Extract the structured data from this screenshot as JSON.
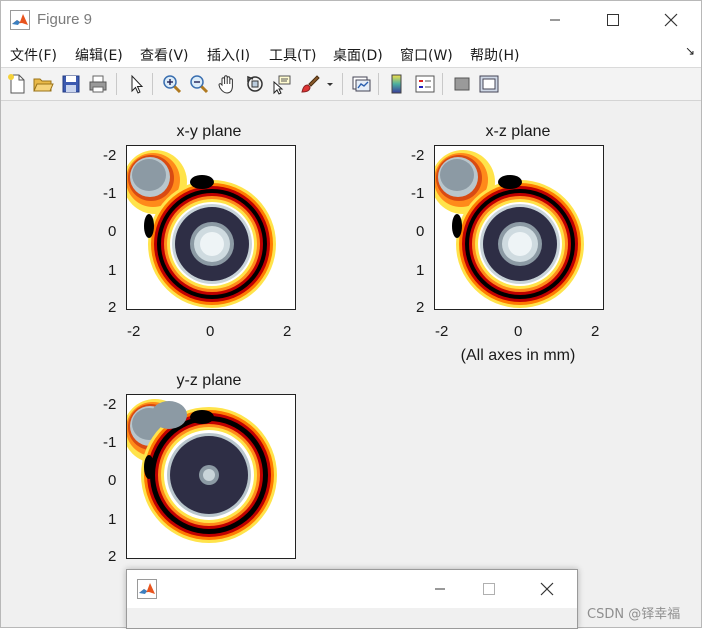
{
  "window": {
    "title": "Figure 9"
  },
  "menu": [
    "文件(F)",
    "编辑(E)",
    "查看(V)",
    "插入(I)",
    "工具(T)",
    "桌面(D)",
    "窗口(W)",
    "帮助(H)"
  ],
  "toolbar_icons": [
    "new-figure-icon",
    "open-file-icon",
    "save-icon",
    "print-icon",
    "select-pointer-icon",
    "zoom-in-icon",
    "zoom-out-icon",
    "pan-hand-icon",
    "rotate-3d-icon",
    "data-cursor-icon",
    "brush-icon",
    "brush-dropdown-icon",
    "link-plot-icon",
    "colorbar-icon",
    "legend-icon",
    "hide-plot-tools-icon",
    "show-plot-tools-icon"
  ],
  "plots": {
    "xy": {
      "title": "x-y plane",
      "yticks": [
        "-2",
        "-1",
        "0",
        "1",
        "2"
      ],
      "xticks": [
        "-2",
        "0",
        "2"
      ]
    },
    "xz": {
      "title": "x-z plane",
      "yticks": [
        "-2",
        "-1",
        "0",
        "1",
        "2"
      ],
      "xticks": [
        "-2",
        "0",
        "2"
      ],
      "note": "(All axes in mm)"
    },
    "yz": {
      "title": "y-z plane",
      "yticks": [
        "-2",
        "-1",
        "0",
        "1",
        "2"
      ]
    }
  },
  "colors": {
    "hot_black": "#000000",
    "hot_red": "#c00000",
    "hot_orange": "#ff7a00",
    "hot_yellow": "#ffe000",
    "bone_dark": "#2e2e45",
    "bone_mid": "#8c9aa4",
    "bone_light": "#e8f0f2"
  },
  "watermark": "CSDN @铎幸福"
}
